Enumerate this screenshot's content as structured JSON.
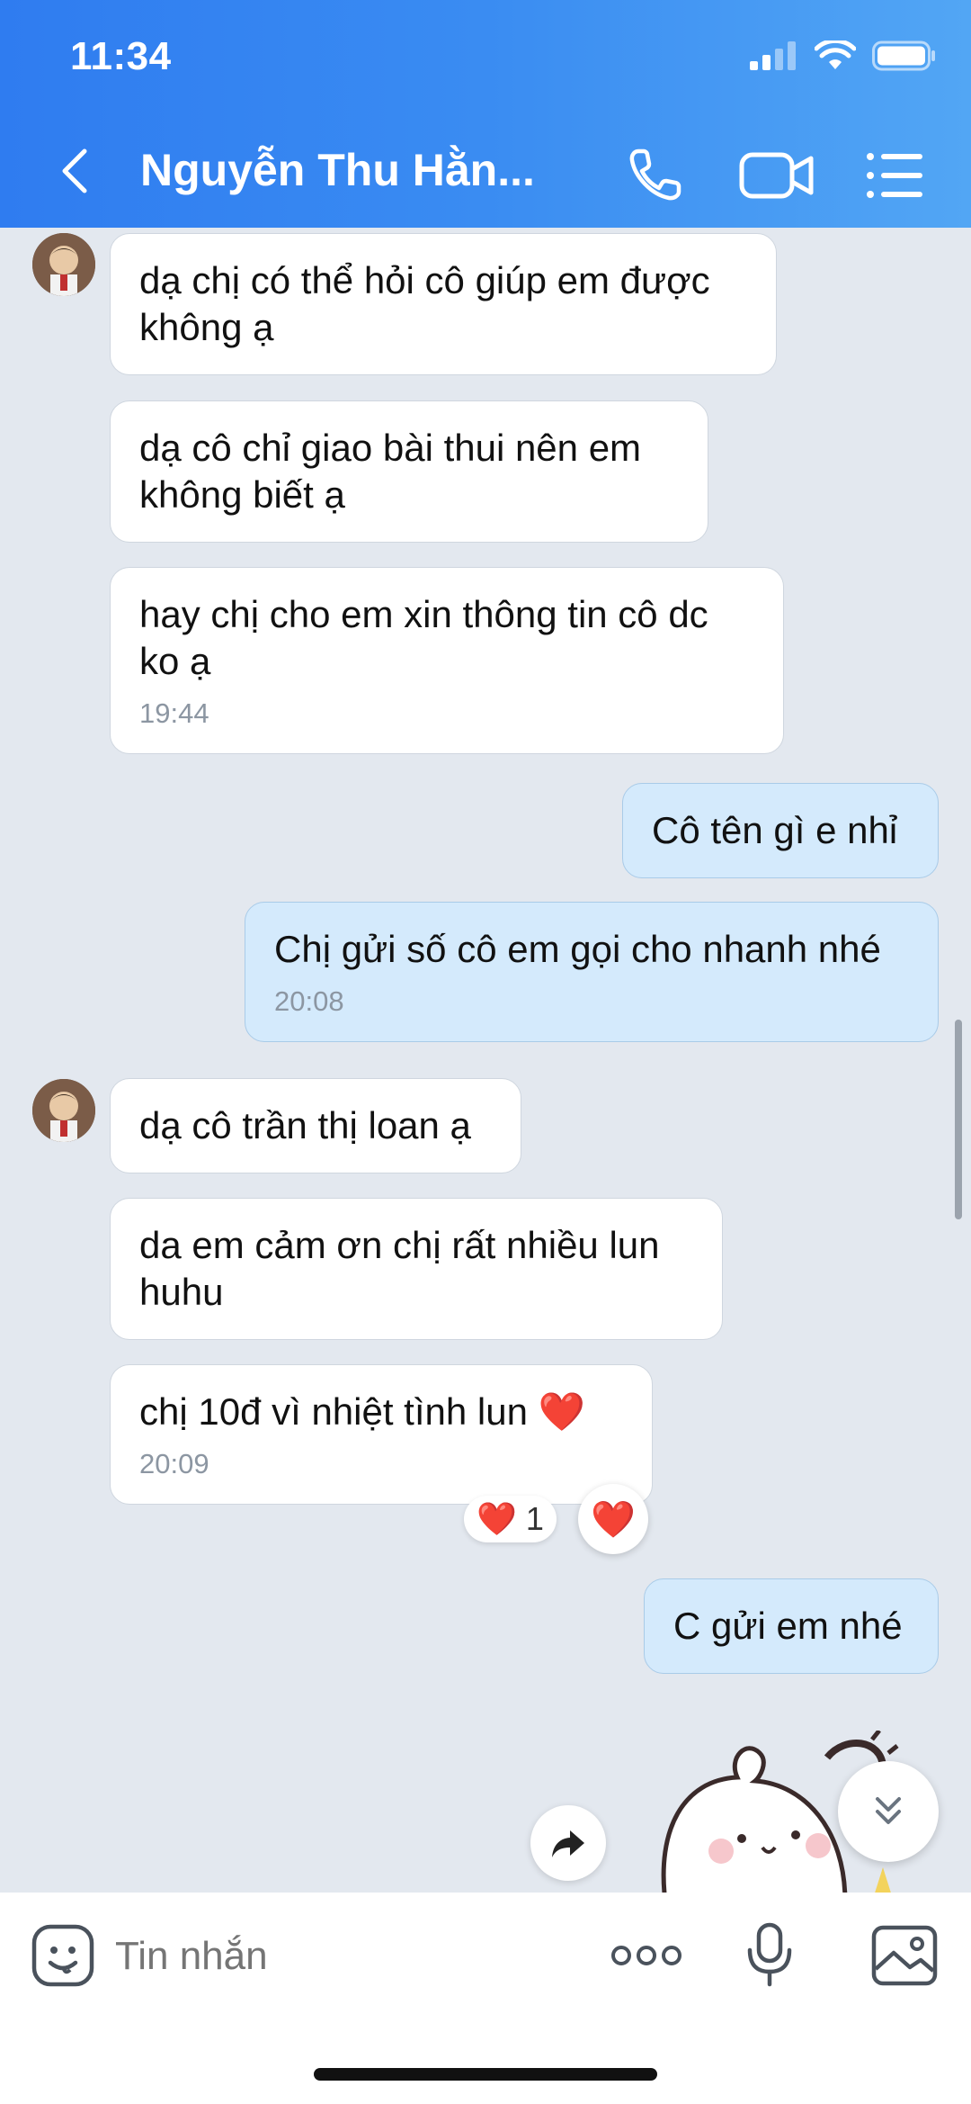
{
  "status_bar": {
    "time": "11:34"
  },
  "header": {
    "title": "Nguyễn Thu Hằn...",
    "icons": [
      "back-chevron-icon",
      "phone-icon",
      "video-call-icon",
      "menu-list-icon"
    ]
  },
  "messages": [
    {
      "dir": "in",
      "text": "dạ chị có thể hỏi cô giúp em được không ạ",
      "time": ""
    },
    {
      "dir": "in",
      "text": "dạ cô chỉ giao bài thui nên em không biết ạ",
      "time": ""
    },
    {
      "dir": "in",
      "text": "hay chị cho em xin thông tin cô dc ko ạ",
      "time": "19:44"
    },
    {
      "dir": "out",
      "text": "Cô tên gì e nhỉ",
      "time": ""
    },
    {
      "dir": "out",
      "text": "Chị gửi số cô em gọi cho nhanh nhé",
      "time": "20:08"
    },
    {
      "dir": "in",
      "text": "dạ cô trần thị loan ạ",
      "time": ""
    },
    {
      "dir": "in",
      "text": "da em cảm ơn chị rất nhiều lun huhu",
      "time": ""
    },
    {
      "dir": "in",
      "text": "chị 10đ  vì nhiệt tình lun ❤️",
      "time": "20:09"
    },
    {
      "dir": "out",
      "text": "C gửi em nhé",
      "time": ""
    }
  ],
  "reaction": {
    "emoji": "❤️",
    "count": "1",
    "button_emoji": "❤️"
  },
  "input_bar": {
    "placeholder": "Tin nhắn",
    "icons": [
      "sticker-icon",
      "more-dots-icon",
      "microphone-icon",
      "image-gallery-icon"
    ]
  },
  "colors": {
    "header_gradient_start": "#2f7cf0",
    "header_gradient_end": "#52a6f4",
    "chat_bg": "#e3e8ef",
    "outgoing_bubble": "#d4eafc",
    "incoming_bubble": "#ffffff"
  }
}
